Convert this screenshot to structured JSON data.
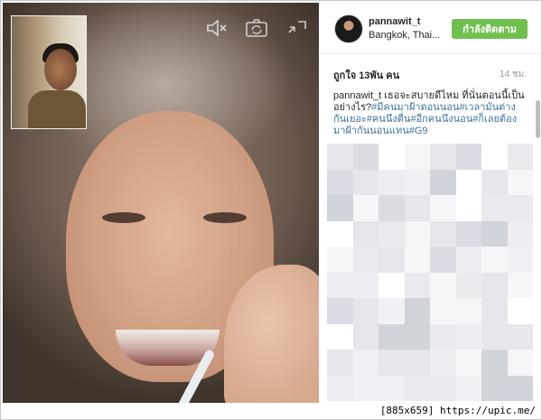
{
  "post": {
    "username": "pannawit_t",
    "location": "Bangkok, Thai...",
    "follow_label": "กำลังติดตาม",
    "likes": "ถูกใจ 13พัน คน",
    "time": "14 ชม.",
    "caption_user": "pannawit_t",
    "caption_text": "เธอจะสบายดีไหม ที่นั่นตอนนี้เป็นอย่างไร?",
    "caption_tags": "#มีคนมาฝ้าตอนนอน#เวลามันต่างกันเยอะ#คนนึงตื่น#อีกคนนึงนอน#ก็เลยต้องมาฝ้ากันนอนแทน#G9"
  },
  "overlay": {
    "icons": [
      "mute-icon",
      "camera-flip-icon",
      "end-call-icon"
    ]
  },
  "watermark": "[885x659] https://upic.me/",
  "colors": {
    "follow_button": "#70c050",
    "hashtag": "#3f729b",
    "muted_text": "#999999"
  }
}
